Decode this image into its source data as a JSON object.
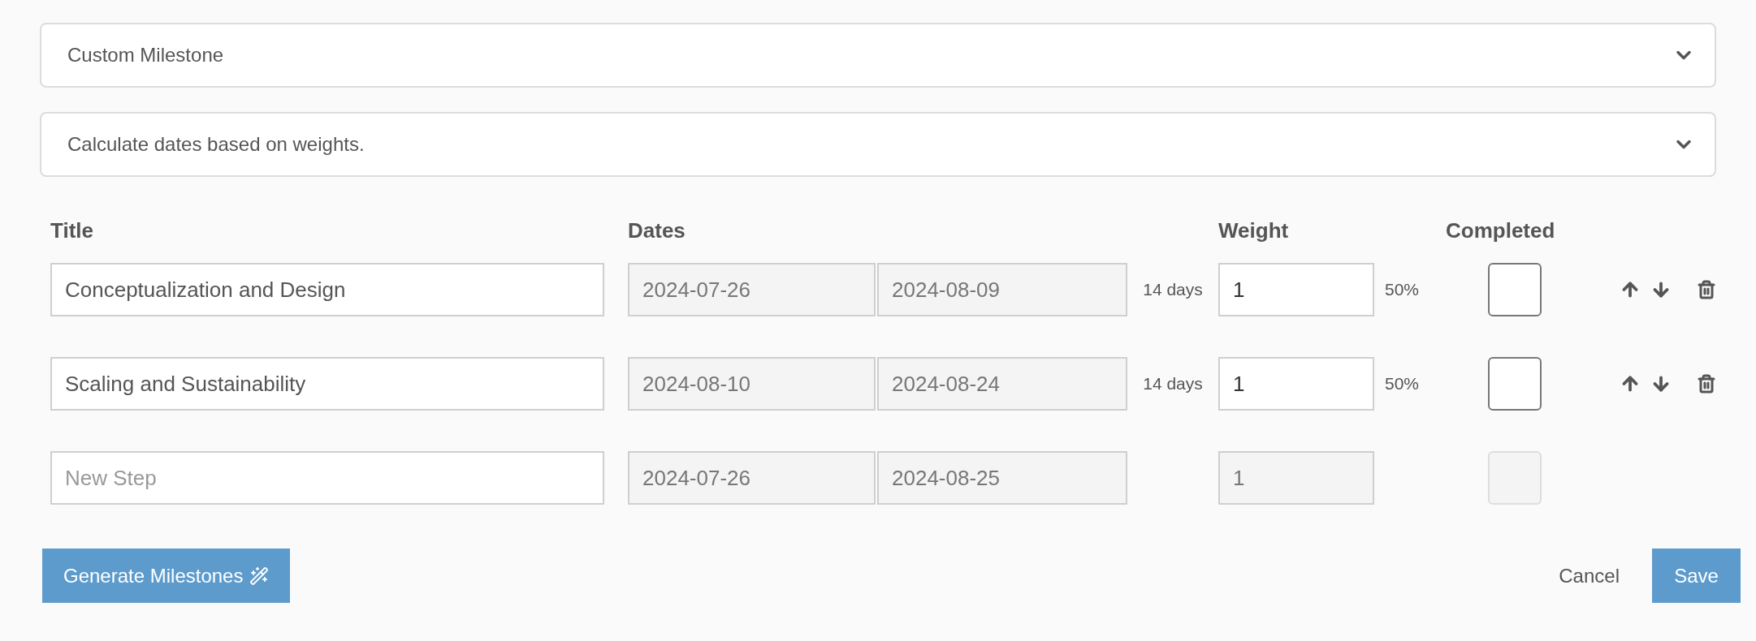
{
  "milestone_type": {
    "value": "Custom Milestone"
  },
  "date_mode": {
    "value": "Calculate dates based on weights."
  },
  "columns": [
    "Title",
    "Dates",
    "Weight",
    "Completed"
  ],
  "steps": [
    {
      "kind": "step",
      "title": "Conceptualization and Design",
      "start": "2024-07-26",
      "end": "2024-08-09",
      "duration": "14 days",
      "weight": "1",
      "share": "50%",
      "completed": false,
      "disabled": false
    },
    {
      "kind": "step",
      "title": "Scaling and Sustainability",
      "start": "2024-08-10",
      "end": "2024-08-24",
      "duration": "14 days",
      "weight": "1",
      "share": "50%",
      "completed": false,
      "disabled": false
    },
    {
      "kind": "new",
      "placeholder": "New Step",
      "start": "2024-07-26",
      "end": "2024-08-25",
      "weight": "1",
      "completed": false,
      "disabled": true
    }
  ],
  "buttons": {
    "generate": "Generate Milestones",
    "cancel": "Cancel",
    "save": "Save"
  }
}
